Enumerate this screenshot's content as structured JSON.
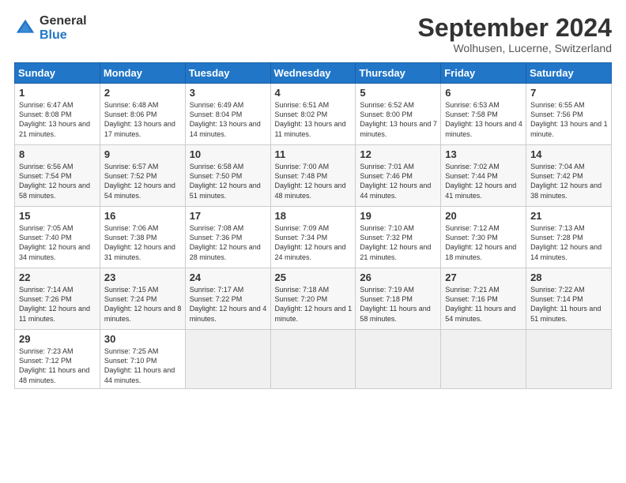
{
  "logo": {
    "general": "General",
    "blue": "Blue"
  },
  "title": "September 2024",
  "subtitle": "Wolhusen, Lucerne, Switzerland",
  "days": [
    "Sunday",
    "Monday",
    "Tuesday",
    "Wednesday",
    "Thursday",
    "Friday",
    "Saturday"
  ],
  "weeks": [
    [
      {
        "day": "1",
        "sunrise": "6:47 AM",
        "sunset": "8:08 PM",
        "daylight": "13 hours and 21 minutes."
      },
      {
        "day": "2",
        "sunrise": "6:48 AM",
        "sunset": "8:06 PM",
        "daylight": "13 hours and 17 minutes."
      },
      {
        "day": "3",
        "sunrise": "6:49 AM",
        "sunset": "8:04 PM",
        "daylight": "13 hours and 14 minutes."
      },
      {
        "day": "4",
        "sunrise": "6:51 AM",
        "sunset": "8:02 PM",
        "daylight": "13 hours and 11 minutes."
      },
      {
        "day": "5",
        "sunrise": "6:52 AM",
        "sunset": "8:00 PM",
        "daylight": "13 hours and 7 minutes."
      },
      {
        "day": "6",
        "sunrise": "6:53 AM",
        "sunset": "7:58 PM",
        "daylight": "13 hours and 4 minutes."
      },
      {
        "day": "7",
        "sunrise": "6:55 AM",
        "sunset": "7:56 PM",
        "daylight": "13 hours and 1 minute."
      }
    ],
    [
      {
        "day": "8",
        "sunrise": "6:56 AM",
        "sunset": "7:54 PM",
        "daylight": "12 hours and 58 minutes."
      },
      {
        "day": "9",
        "sunrise": "6:57 AM",
        "sunset": "7:52 PM",
        "daylight": "12 hours and 54 minutes."
      },
      {
        "day": "10",
        "sunrise": "6:58 AM",
        "sunset": "7:50 PM",
        "daylight": "12 hours and 51 minutes."
      },
      {
        "day": "11",
        "sunrise": "7:00 AM",
        "sunset": "7:48 PM",
        "daylight": "12 hours and 48 minutes."
      },
      {
        "day": "12",
        "sunrise": "7:01 AM",
        "sunset": "7:46 PM",
        "daylight": "12 hours and 44 minutes."
      },
      {
        "day": "13",
        "sunrise": "7:02 AM",
        "sunset": "7:44 PM",
        "daylight": "12 hours and 41 minutes."
      },
      {
        "day": "14",
        "sunrise": "7:04 AM",
        "sunset": "7:42 PM",
        "daylight": "12 hours and 38 minutes."
      }
    ],
    [
      {
        "day": "15",
        "sunrise": "7:05 AM",
        "sunset": "7:40 PM",
        "daylight": "12 hours and 34 minutes."
      },
      {
        "day": "16",
        "sunrise": "7:06 AM",
        "sunset": "7:38 PM",
        "daylight": "12 hours and 31 minutes."
      },
      {
        "day": "17",
        "sunrise": "7:08 AM",
        "sunset": "7:36 PM",
        "daylight": "12 hours and 28 minutes."
      },
      {
        "day": "18",
        "sunrise": "7:09 AM",
        "sunset": "7:34 PM",
        "daylight": "12 hours and 24 minutes."
      },
      {
        "day": "19",
        "sunrise": "7:10 AM",
        "sunset": "7:32 PM",
        "daylight": "12 hours and 21 minutes."
      },
      {
        "day": "20",
        "sunrise": "7:12 AM",
        "sunset": "7:30 PM",
        "daylight": "12 hours and 18 minutes."
      },
      {
        "day": "21",
        "sunrise": "7:13 AM",
        "sunset": "7:28 PM",
        "daylight": "12 hours and 14 minutes."
      }
    ],
    [
      {
        "day": "22",
        "sunrise": "7:14 AM",
        "sunset": "7:26 PM",
        "daylight": "12 hours and 11 minutes."
      },
      {
        "day": "23",
        "sunrise": "7:15 AM",
        "sunset": "7:24 PM",
        "daylight": "12 hours and 8 minutes."
      },
      {
        "day": "24",
        "sunrise": "7:17 AM",
        "sunset": "7:22 PM",
        "daylight": "12 hours and 4 minutes."
      },
      {
        "day": "25",
        "sunrise": "7:18 AM",
        "sunset": "7:20 PM",
        "daylight": "12 hours and 1 minute."
      },
      {
        "day": "26",
        "sunrise": "7:19 AM",
        "sunset": "7:18 PM",
        "daylight": "11 hours and 58 minutes."
      },
      {
        "day": "27",
        "sunrise": "7:21 AM",
        "sunset": "7:16 PM",
        "daylight": "11 hours and 54 minutes."
      },
      {
        "day": "28",
        "sunrise": "7:22 AM",
        "sunset": "7:14 PM",
        "daylight": "11 hours and 51 minutes."
      }
    ],
    [
      {
        "day": "29",
        "sunrise": "7:23 AM",
        "sunset": "7:12 PM",
        "daylight": "11 hours and 48 minutes."
      },
      {
        "day": "30",
        "sunrise": "7:25 AM",
        "sunset": "7:10 PM",
        "daylight": "11 hours and 44 minutes."
      },
      null,
      null,
      null,
      null,
      null
    ]
  ]
}
